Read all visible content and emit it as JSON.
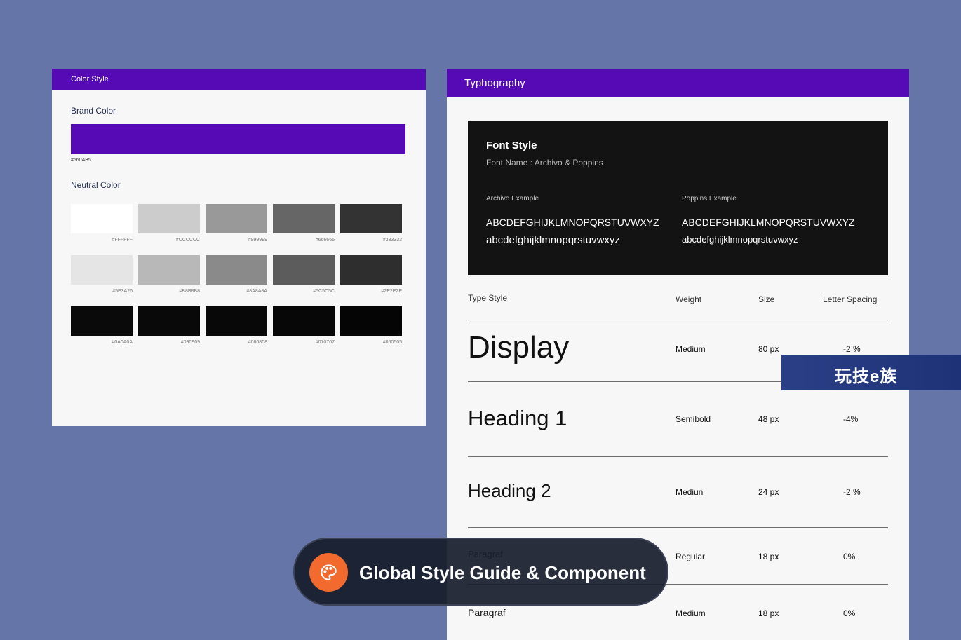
{
  "color_style": {
    "title": "Color Style",
    "brand_label": "Brand Color",
    "brand_hex": "#560AB5",
    "neutral_label": "Neutral Color",
    "neutral_rows": [
      [
        {
          "hex": "#FFFFFF",
          "color": "#FFFFFF"
        },
        {
          "hex": "#CCCCCC",
          "color": "#CCCCCC"
        },
        {
          "hex": "#999999",
          "color": "#999999"
        },
        {
          "hex": "#666666",
          "color": "#666666"
        },
        {
          "hex": "#333333",
          "color": "#333333"
        }
      ],
      [
        {
          "hex": "#5E3A26",
          "color": "#E5E5E5"
        },
        {
          "hex": "#B8B8B8",
          "color": "#B8B8B8"
        },
        {
          "hex": "#8A8A8A",
          "color": "#8A8A8A"
        },
        {
          "hex": "#5C5C5C",
          "color": "#5C5C5C"
        },
        {
          "hex": "#2E2E2E",
          "color": "#2E2E2E"
        }
      ],
      [
        {
          "hex": "#0A0A0A",
          "color": "#0A0A0A"
        },
        {
          "hex": "#090909",
          "color": "#090909"
        },
        {
          "hex": "#080808",
          "color": "#080808"
        },
        {
          "hex": "#070707",
          "color": "#070707"
        },
        {
          "hex": "#050505",
          "color": "#050505"
        }
      ]
    ]
  },
  "typography": {
    "title": "Typhography",
    "font_card": {
      "title": "Font Style",
      "font_name": "Font Name : Archivo &  Poppins",
      "archivo": {
        "label": "Archivo Example",
        "upper": "ABCDEFGHIJKLMNOPQRSTUVWXYZ",
        "lower": "abcdefghijklmnopqrstuvwxyz"
      },
      "poppins": {
        "label": "Poppins Example",
        "upper": "ABCDEFGHIJKLMNOPQRSTUVWXYZ",
        "lower": "abcdefghijklmnopqrstuvwxyz"
      }
    },
    "headers": {
      "type_style": "Type Style",
      "weight": "Weight",
      "size": "Size",
      "letter_spacing": "Letter Spacing"
    },
    "rows": [
      {
        "style": "Display",
        "weight": "Medium",
        "size": "80 px",
        "ls": "-2 %"
      },
      {
        "style": "Heading 1",
        "weight": "Semibold",
        "size": "48 px",
        "ls": "-4%"
      },
      {
        "style": "Heading 2",
        "weight": "Mediun",
        "size": "24 px",
        "ls": "-2 %"
      },
      {
        "style": "Paragraf",
        "weight": "Regular",
        "size": "18 px",
        "ls": "0%"
      },
      {
        "style": "Paragraf",
        "weight": "Medium",
        "size": "18 px",
        "ls": "0%"
      }
    ]
  },
  "watermark": {
    "text": "玩技e族"
  },
  "banner": {
    "text": "Global Style Guide & Component",
    "icon": "palette-icon",
    "accent": "#F26A2E"
  },
  "colors": {
    "background": "#6575A8",
    "brand": "#560AB5",
    "card_dark": "#131313"
  }
}
